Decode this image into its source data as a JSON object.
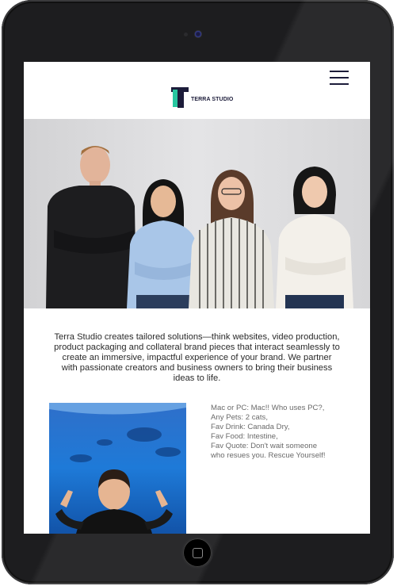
{
  "site": {
    "logo_text": "TERRA STUDIO",
    "menu_icon": "hamburger-menu-icon"
  },
  "hero": {
    "alt": "Team photo of four people"
  },
  "intro": {
    "text": "Terra Studio creates tailored solutions—think websites, video production, product packaging and collateral brand pieces that interact seamlessly to create an immersive, impactful experience of your brand. We partner with passionate creators and business owners to bring their business ideas to life."
  },
  "profile": {
    "facts": [
      "Mac or PC: Mac!! Who uses PC?,",
      "Any Pets: 2 cats,",
      "Fav Drink: Canada Dry,",
      "Fav Food: Intestine,",
      "Fav Quote: Don't wait someone",
      "who resues you. Rescue Yourself!"
    ]
  },
  "colors": {
    "brand_dark": "#1c1c3a",
    "brand_accent": "#27c7a0",
    "device_frame": "#1d1d1f"
  }
}
